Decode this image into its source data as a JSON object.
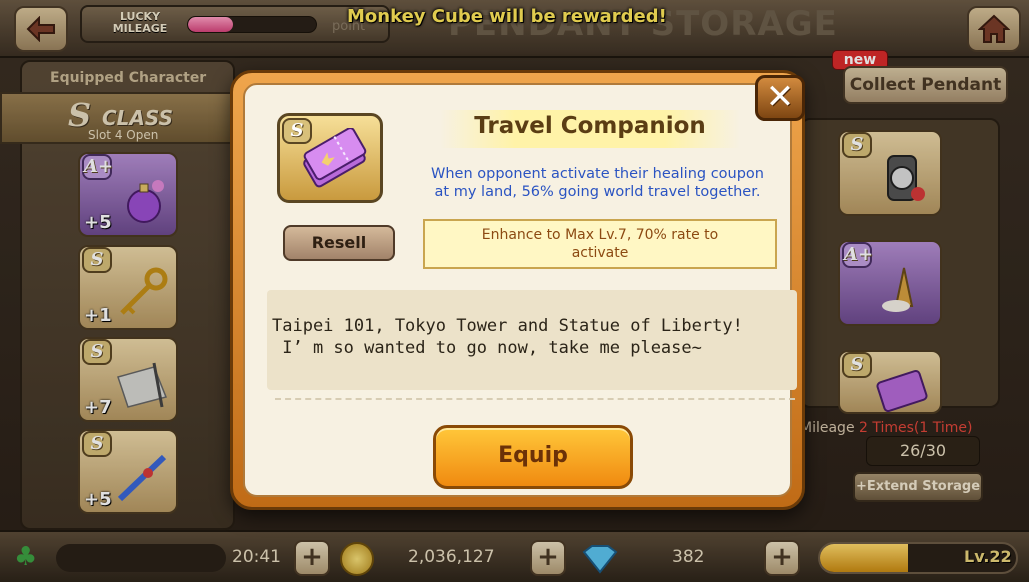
{
  "top": {
    "mileage_label": "LUCKY\nMILEAGE",
    "mileage_fill": 0.35,
    "mileage_point_label": "point",
    "storage_title": "PENDANT STORAGE",
    "reward_banner": "Monkey Cube will be rewarded!"
  },
  "left": {
    "equipped_title": "Equipped Character",
    "class_letter": "S",
    "class_word": "CLASS",
    "slot_open": "Slot 4 Open",
    "slots": [
      {
        "grade": "A+",
        "plus": "+5",
        "icon": "perfume-bottle-icon"
      },
      {
        "grade": "S",
        "plus": "+1",
        "icon": "golden-key-icon"
      },
      {
        "grade": "S",
        "plus": "+7",
        "icon": "blueprint-icon"
      },
      {
        "grade": "S",
        "plus": "+5",
        "icon": "blue-sword-icon"
      }
    ]
  },
  "right": {
    "new_badge": "new",
    "collect_label": "Collect Pendant",
    "mileage_text": "Mileage",
    "mileage_times": "2 Times(1 Time)",
    "slot_count": "26/30",
    "extend_label": "+Extend Storage",
    "cards": [
      {
        "grade": "S",
        "icon": "watch-icon"
      },
      {
        "grade": "A+",
        "icon": "ice-cream-icon"
      },
      {
        "grade": "S",
        "icon": "ticket-icon"
      }
    ]
  },
  "bottom": {
    "timer": "20:41",
    "coins": "2,036,127",
    "gems": "382",
    "level": "Lv.22",
    "exp_fill": 0.45
  },
  "modal": {
    "item_grade": "S",
    "item_icon": "travel-ticket-icon",
    "title": "Travel Companion",
    "desc_line1": "When opponent activate their healing coupon",
    "desc_line2": "at my land, 56% going world travel together.",
    "resell_label": "Resell",
    "enhance_line1": "Enhance to Max Lv.7, 70% rate to",
    "enhance_line2": "activate",
    "flavor_line1": "Taipei 101, Tokyo Tower and Statue of Liberty!",
    "flavor_line2": " I’ m so wanted to go now, take me please~",
    "equip_label": "Equip",
    "close_glyph": "✕"
  },
  "colors": {
    "accent_orange": "#f08a10",
    "desc_blue": "#2b54c2",
    "enhance_text": "#8c4a12"
  }
}
